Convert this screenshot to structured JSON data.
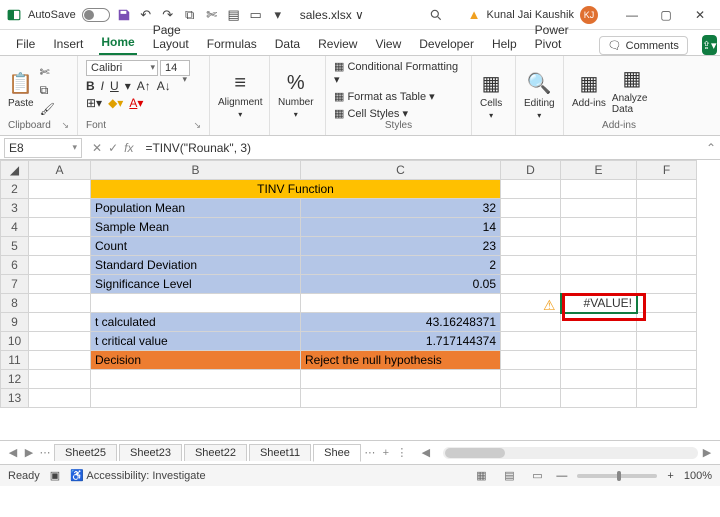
{
  "titlebar": {
    "autosave": "AutoSave",
    "filename": "sales.xlsx  ∨",
    "username": "Kunal Jai Kaushik",
    "initials": "KJ"
  },
  "menu": {
    "file": "File",
    "insert": "Insert",
    "home": "Home",
    "pageLayout": "Page Layout",
    "formulas": "Formulas",
    "data": "Data",
    "review": "Review",
    "view": "View",
    "developer": "Developer",
    "help": "Help",
    "powerPivot": "Power Pivot",
    "comments": "Comments"
  },
  "ribbon": {
    "clipboard": {
      "label": "Clipboard",
      "paste": "Paste"
    },
    "font": {
      "label": "Font",
      "name": "Calibri",
      "size": "14"
    },
    "alignment": {
      "label": "Alignment",
      "btn": "Alignment"
    },
    "number": {
      "label": "Number",
      "btn": "Number"
    },
    "styles": {
      "label": "Styles",
      "cf": "Conditional Formatting",
      "fat": "Format as Table",
      "cs": "Cell Styles"
    },
    "cells": {
      "label": "Cells",
      "btn": "Cells"
    },
    "editing": {
      "label": "Editing",
      "btn": "Editing"
    },
    "addins": {
      "label": "Add-ins",
      "btn": "Add-ins",
      "analyze": "Analyze Data"
    }
  },
  "formulaBar": {
    "cellRef": "E8",
    "formula": "=TINV(\"Rounak\", 3)"
  },
  "cols": [
    "A",
    "B",
    "C",
    "D",
    "E",
    "F"
  ],
  "rows": [
    "2",
    "3",
    "4",
    "5",
    "6",
    "7",
    "8",
    "9",
    "10",
    "11",
    "12",
    "13"
  ],
  "cells": {
    "title": "TINV Function",
    "b3": "Population Mean",
    "c3": "32",
    "b4": "Sample Mean",
    "c4": "14",
    "b5": "Count",
    "c5": "23",
    "b6": "Standard Deviation",
    "c6": "2",
    "b7": "Significance Level",
    "c7": "0.05",
    "b9": "t calculated",
    "c9": "43.16248371",
    "b10": "t critical value",
    "c10": "1.717144374",
    "b11": "Decision",
    "c11": "Reject the null hypothesis",
    "e8": "#VALUE!"
  },
  "sheetTabs": [
    "Sheet25",
    "Sheet23",
    "Sheet22",
    "Sheet11",
    "Shee"
  ],
  "status": {
    "ready": "Ready",
    "accessibility": "Accessibility: Investigate",
    "zoom": "100%"
  }
}
